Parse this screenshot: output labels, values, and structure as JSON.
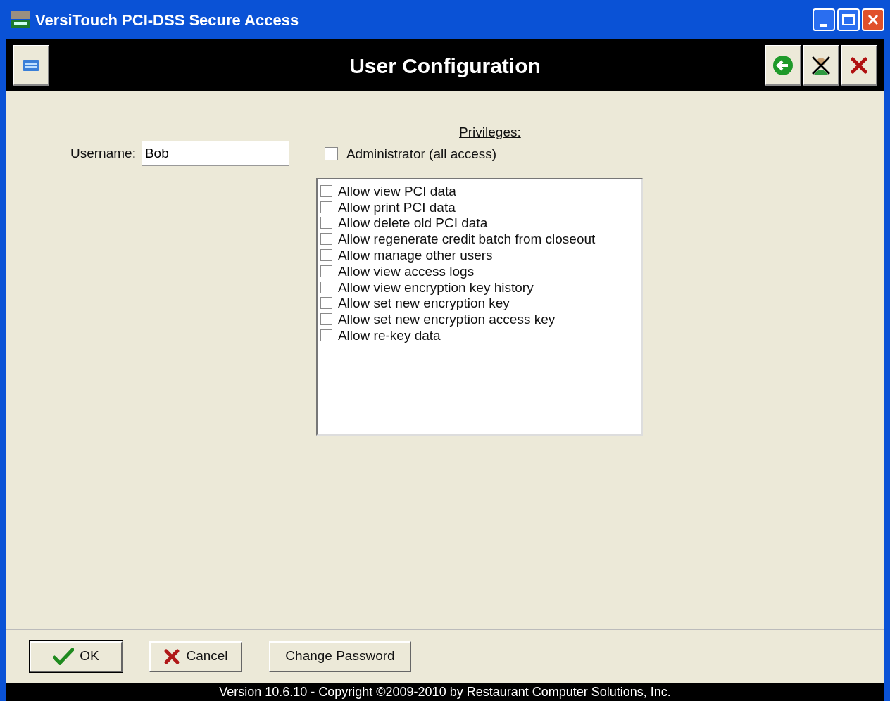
{
  "window": {
    "title": "VersiTouch PCI-DSS Secure Access"
  },
  "header": {
    "title": "User Configuration"
  },
  "username": {
    "label": "Username:",
    "value": "Bob"
  },
  "privileges": {
    "heading": "Privileges:",
    "admin": {
      "label": "Administrator (all access)",
      "checked": false
    },
    "items": [
      {
        "label": "Allow view PCI data",
        "checked": false
      },
      {
        "label": "Allow print PCI data",
        "checked": false
      },
      {
        "label": "Allow delete old PCI data",
        "checked": false
      },
      {
        "label": "Allow regenerate credit batch from closeout",
        "checked": false
      },
      {
        "label": "Allow manage other users",
        "checked": false
      },
      {
        "label": "Allow view access logs",
        "checked": false
      },
      {
        "label": "Allow view encryption key history",
        "checked": false
      },
      {
        "label": "Allow set new encryption key",
        "checked": false
      },
      {
        "label": "Allow set new encryption access key",
        "checked": false
      },
      {
        "label": "Allow re-key data",
        "checked": false
      }
    ]
  },
  "buttons": [
    {
      "kind": "ok",
      "label": "OK"
    },
    {
      "kind": "cancel",
      "label": "Cancel"
    },
    {
      "kind": "plain",
      "label": "Change Password"
    }
  ],
  "footer": "Version 10.6.10 - Copyright ©2009-2010 by Restaurant Computer Solutions, Inc."
}
